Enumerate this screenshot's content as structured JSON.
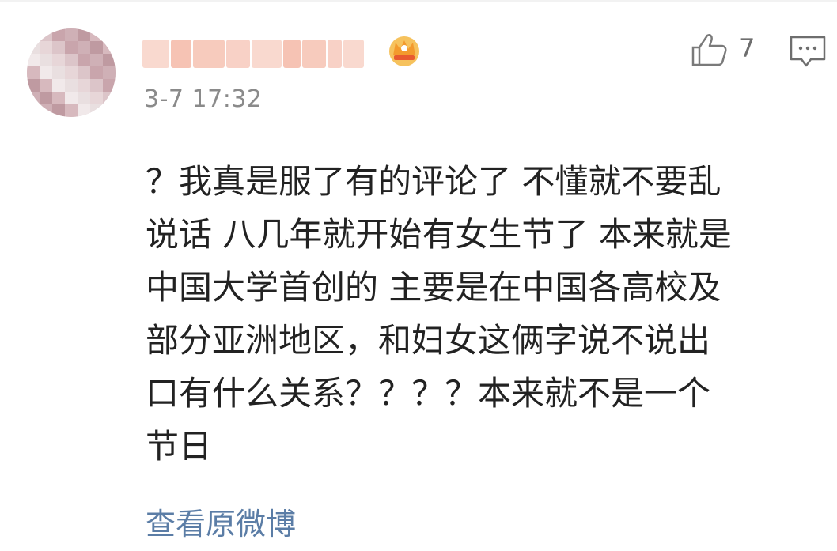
{
  "comment": {
    "author_badge_icon": "crown-badge-icon",
    "timestamp": "3-7 17:32",
    "like_count": "7",
    "lines": [
      "？我真是服了有的评论了 不懂就不要乱",
      "说话 八几年就开始有女生节了 本来就是",
      "中国大学首创的  主要是在中国各高校及",
      "部分亚洲地区，和妇女这俩字说不说出",
      "口有什么关系？？？？本来就不是一个",
      "节日"
    ],
    "source_link": "查看原微博"
  },
  "colors": {
    "link": "#5b7da6",
    "meta": "#8a8a8a",
    "text": "#222222",
    "blurred_name": "#f4b9a7",
    "crown": "#f3b23a"
  },
  "icons": {
    "like": "thumbs-up-icon",
    "comment": "comment-bubble-icon"
  }
}
